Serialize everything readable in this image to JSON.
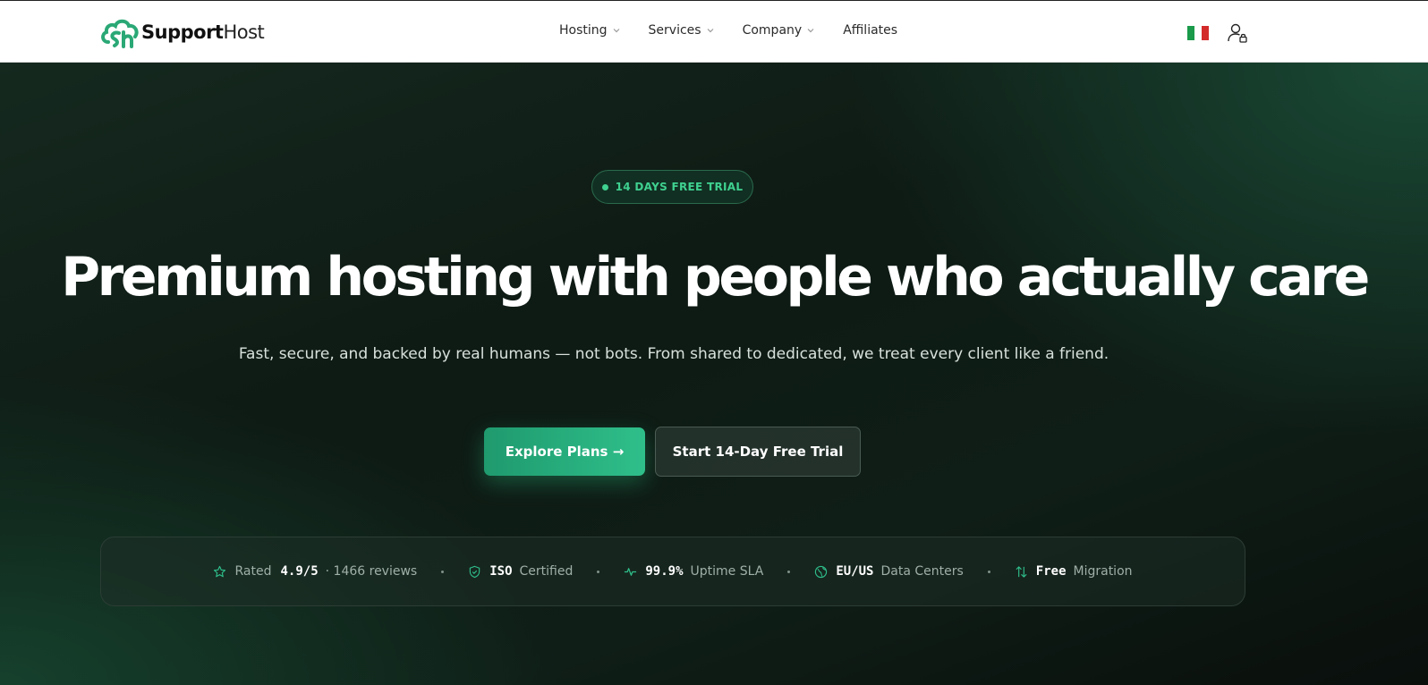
{
  "brand": {
    "bold": "Support",
    "light": "Host",
    "colors": {
      "primary": "#2fbf8b",
      "dark": "#0f1a15"
    }
  },
  "nav": {
    "items": [
      {
        "label": "Hosting",
        "has_dropdown": true
      },
      {
        "label": "Services",
        "has_dropdown": true
      },
      {
        "label": "Company",
        "has_dropdown": true
      },
      {
        "label": "Affiliates",
        "has_dropdown": false
      }
    ],
    "language_flag": "italian-flag-icon",
    "account_icon": "user-lock-icon"
  },
  "hero": {
    "badge": "14 DAYS FREE TRIAL",
    "headline": "Premium hosting with people who actually care",
    "subtitle": "Fast, secure, and backed by real humans — not bots. From shared to dedicated, we treat every client like a friend.",
    "primary_cta": "Explore Plans →",
    "secondary_cta": "Start 14-Day Free Trial"
  },
  "trust": {
    "rating": {
      "icon": "star-icon",
      "pre": "Rated",
      "value": "4.9/5",
      "post": "· 1466 reviews"
    },
    "iso": {
      "icon": "shield-check-icon",
      "value": "ISO",
      "post": "Certified"
    },
    "uptime": {
      "icon": "activity-icon",
      "value": "99.9%",
      "post": "Uptime SLA"
    },
    "datacenters": {
      "icon": "globe-icon",
      "value": "EU/US",
      "post": "Data Centers"
    },
    "migration": {
      "icon": "transfer-arrows-icon",
      "value": "Free",
      "post": "Migration"
    }
  }
}
